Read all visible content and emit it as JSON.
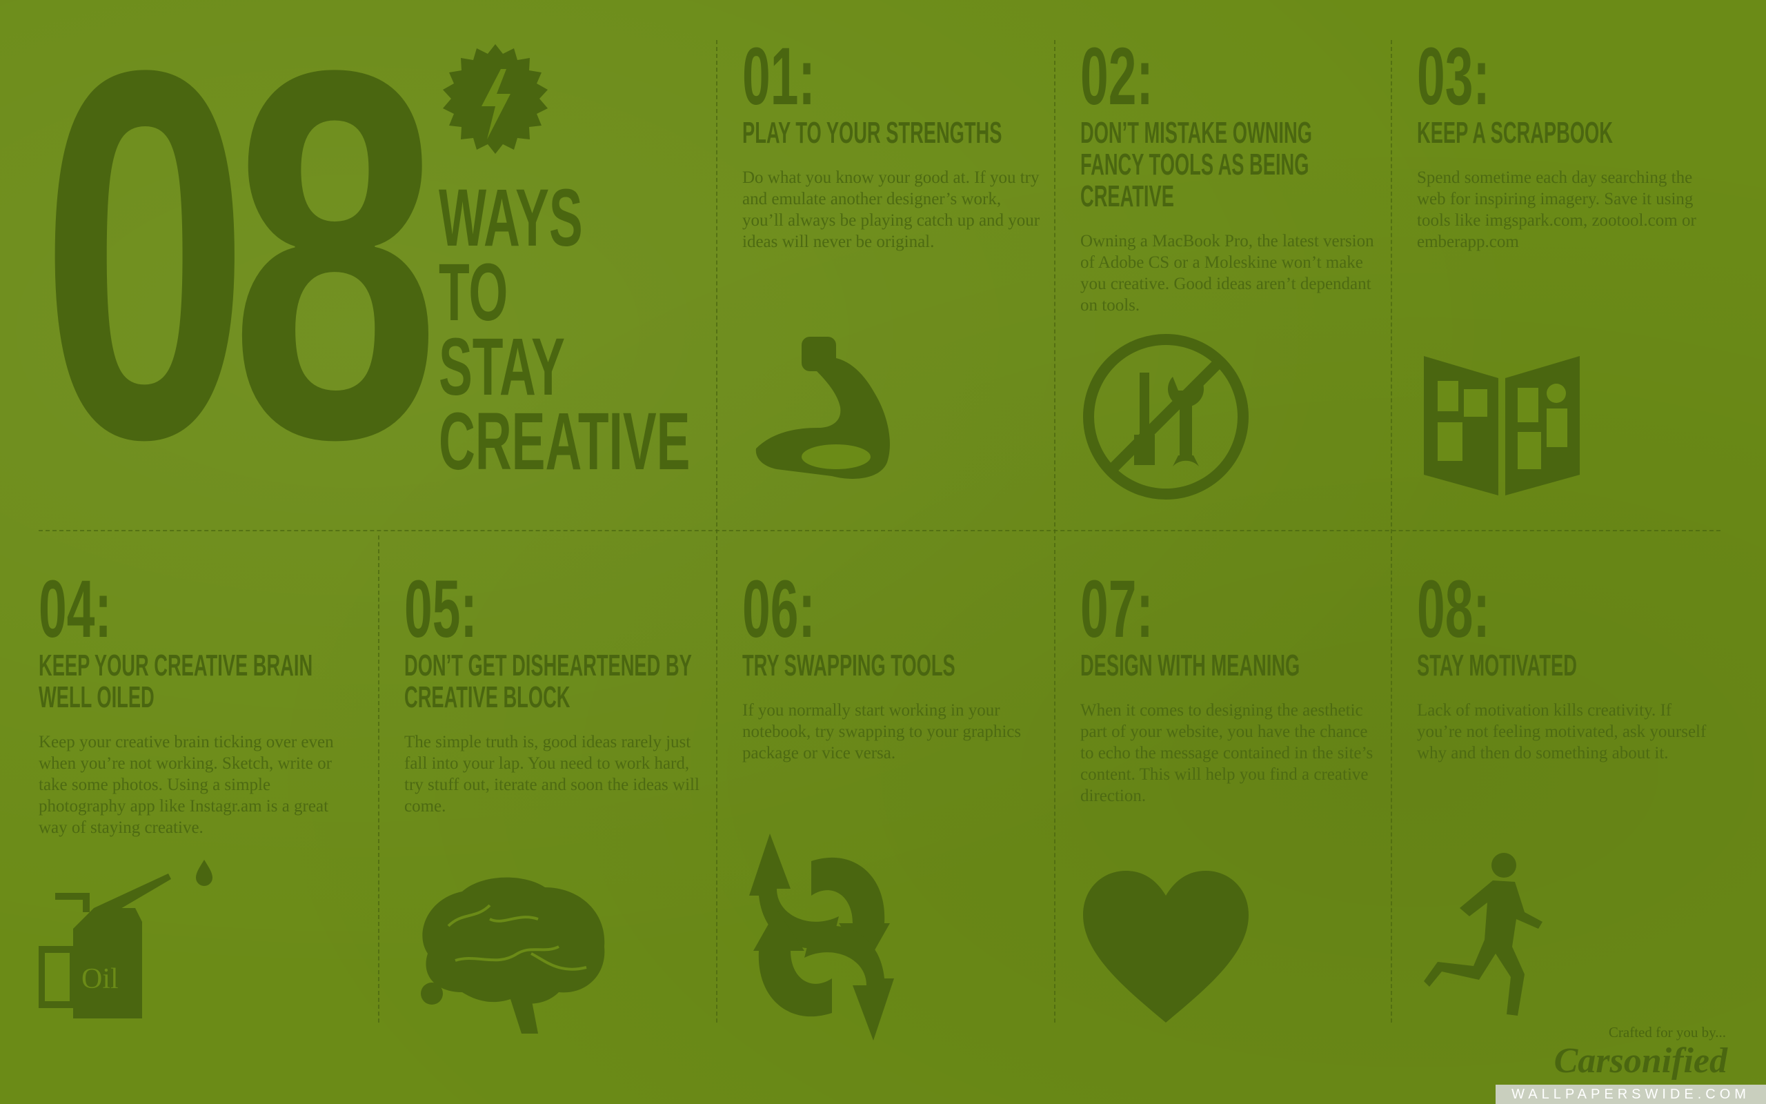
{
  "hero": {
    "number": "08",
    "headline": [
      "WAYS",
      "TO",
      "STAY",
      "CREATIVE"
    ]
  },
  "tips": [
    {
      "num": "01:",
      "title": "PLAY TO YOUR STRENGTHS",
      "body": "Do what you know your good at. If you try and emulate another designer’s work, you’ll always be playing catch up and your ideas will never be original.",
      "icon": "flexed-arm-icon"
    },
    {
      "num": "02:",
      "title": "DON’T MISTAKE OWNING FANCY TOOLS AS BEING CREATIVE",
      "body": "Owning a MacBook Pro, the latest version of Adobe CS or a Moleskine won’t make you creative. Good ideas aren’t dependant on tools.",
      "icon": "no-tools-icon"
    },
    {
      "num": "03:",
      "title": "KEEP A SCRAPBOOK",
      "body": "Spend sometime each day searching the web for inspiring imagery. Save it using tools like imgspark.com, zootool.com or emberapp.com",
      "icon": "scrapbook-icon"
    },
    {
      "num": "04:",
      "title": "KEEP YOUR CREATIVE BRAIN WELL OILED",
      "body": "Keep your creative brain ticking over even when you’re not working. Sketch, write or take some photos. Using a simple photography app like Instagr.am is a great way of staying creative.",
      "icon": "oil-can-icon",
      "icon_label": "Oil"
    },
    {
      "num": "05:",
      "title": "DON’T GET DISHEARTENED BY CREATIVE BLOCK",
      "body": "The simple truth is, good ideas rarely just fall into your lap. You need to work hard, try stuff out, iterate and soon the ideas will come.",
      "icon": "brain-icon"
    },
    {
      "num": "06:",
      "title": "TRY SWAPPING TOOLS",
      "body": "If you normally start working in your notebook, try swapping to your graphics package or vice versa.",
      "icon": "swap-arrows-icon"
    },
    {
      "num": "07:",
      "title": "DESIGN WITH MEANING",
      "body": "When it comes to designing the aesthetic part of your website, you have the chance to echo the message contained in the site’s content. This will help you find a creative direction.",
      "icon": "heart-icon"
    },
    {
      "num": "08:",
      "title": "STAY MOTIVATED",
      "body": "Lack of motivation kills creativity. If you’re not feeling motivated, ask yourself why and then do something about it.",
      "icon": "runner-icon"
    }
  ],
  "footer": {
    "credit": "Crafted for you by...",
    "logo": "Carsonified",
    "watermark": "WALLPAPERSWIDE.COM"
  },
  "colors": {
    "background": "#6b8b17",
    "ink": "#4a6610"
  }
}
